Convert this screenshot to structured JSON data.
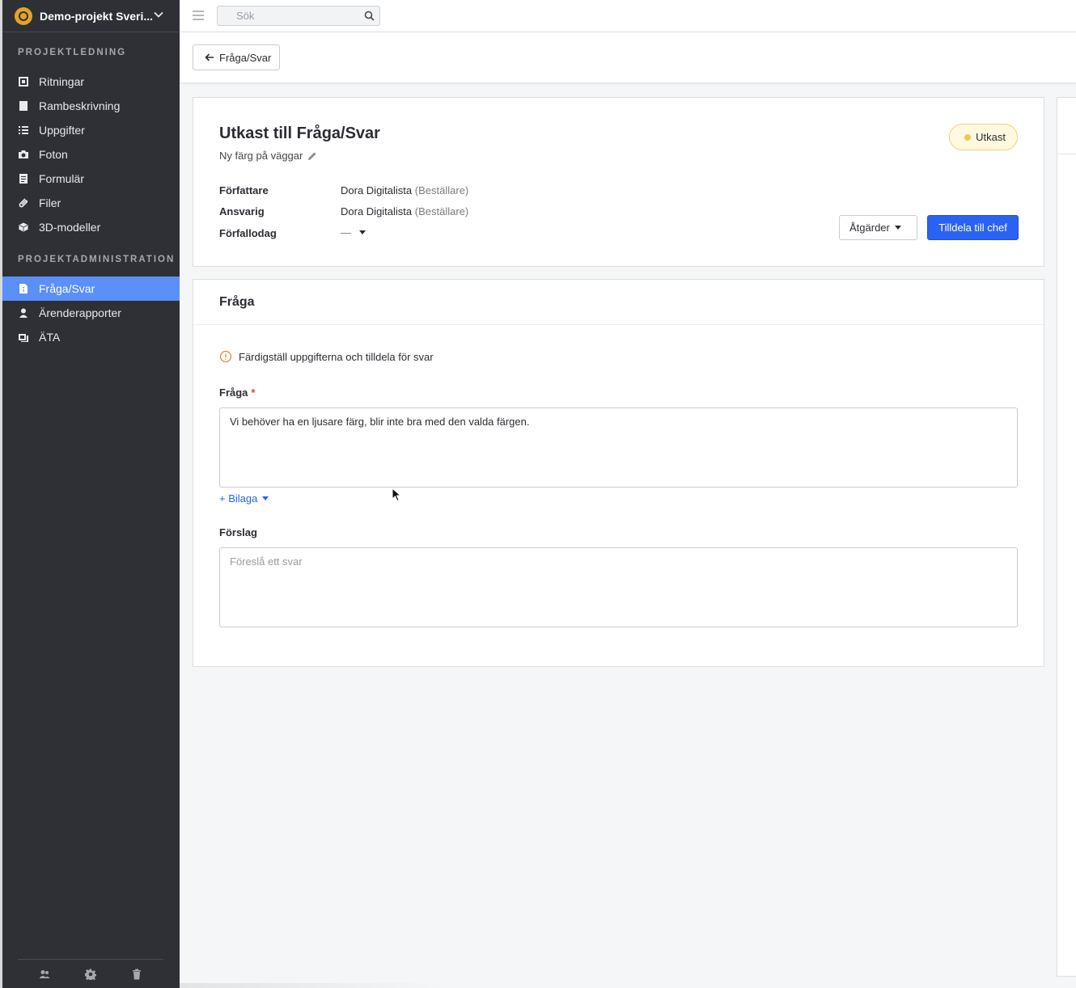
{
  "project": {
    "name": "Demo-projekt Sveri..."
  },
  "sidebar": {
    "section1_title": "PROJEKTLEDNING",
    "section1_items": [
      {
        "label": "Ritningar",
        "icon": "blueprint-icon"
      },
      {
        "label": "Rambeskrivning",
        "icon": "book-icon"
      },
      {
        "label": "Uppgifter",
        "icon": "list-icon"
      },
      {
        "label": "Foton",
        "icon": "camera-icon"
      },
      {
        "label": "Formulär",
        "icon": "form-icon"
      },
      {
        "label": "Filer",
        "icon": "paperclip-icon"
      },
      {
        "label": "3D-modeller",
        "icon": "cube-icon"
      }
    ],
    "section2_title": "PROJEKTADMINISTRATION",
    "section2_items": [
      {
        "label": "Fråga/Svar",
        "icon": "question-doc-icon",
        "active": true
      },
      {
        "label": "Ärenderapporter",
        "icon": "person-icon"
      },
      {
        "label": "ÄTA",
        "icon": "change-order-icon"
      }
    ],
    "footer_icons": [
      "users-icon",
      "gear-icon",
      "trash-icon"
    ]
  },
  "topbar": {
    "search_placeholder": "Sök"
  },
  "subheader": {
    "back_label": "Fråga/Svar"
  },
  "document": {
    "title": "Utkast till Fråga/Svar",
    "subtitle": "Ny färg på väggar",
    "status": "Utkast",
    "status_color": "#f2c94c",
    "author_label": "Författare",
    "author_name": "Dora Digitalista",
    "author_role": "(Beställare)",
    "responsible_label": "Ansvarig",
    "responsible_name": "Dora Digitalista",
    "responsible_role": "(Beställare)",
    "due_label": "Förfallodag",
    "due_value": "—",
    "actions_label": "Åtgärder",
    "assign_label": "Tilldela till chef",
    "accent_color": "#2a62f4"
  },
  "question_section": {
    "title": "Fråga",
    "notice": "Färdigställ uppgifterna och tilldela för svar",
    "question_label": "Fråga",
    "required_mark": "*",
    "question_value": "Vi behöver ha en ljusare färg, blir inte bra med den valda färgen.",
    "attach_label": "+ Bilaga",
    "proposal_label": "Förslag",
    "proposal_placeholder": "Föreslå ett svar"
  }
}
